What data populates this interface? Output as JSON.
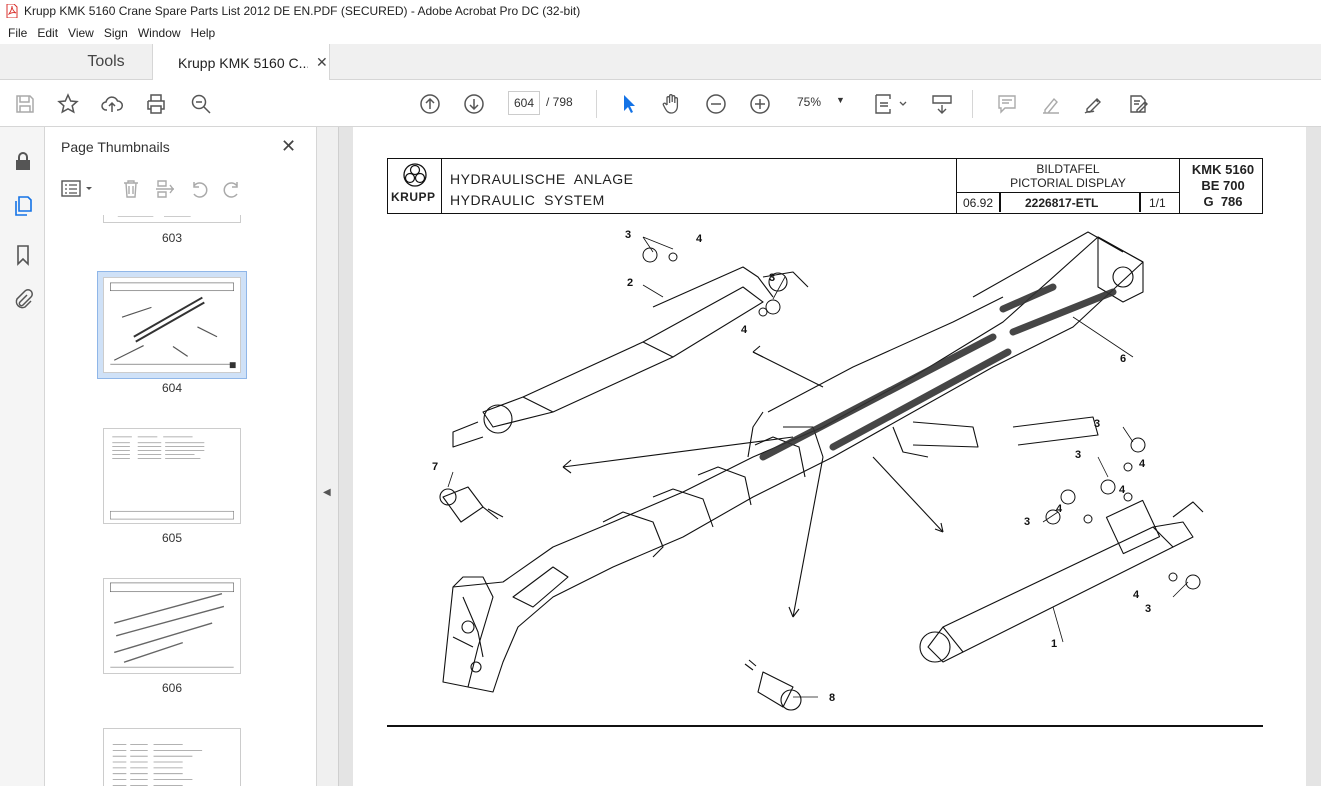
{
  "window": {
    "title": "Krupp KMK 5160 Crane Spare Parts List 2012 DE EN.PDF (SECURED) - Adobe Acrobat Pro DC (32-bit)"
  },
  "menu": [
    "File",
    "Edit",
    "View",
    "Sign",
    "Window",
    "Help"
  ],
  "tabs": {
    "tools": "Tools",
    "document": "Krupp KMK 5160 C..."
  },
  "toolbar": {
    "current_page": "604",
    "total_pages": "/ 798",
    "zoom": "75%"
  },
  "panel": {
    "title": "Page Thumbnails",
    "thumbnails": [
      {
        "page": "603"
      },
      {
        "page": "604",
        "selected": true
      },
      {
        "page": "605"
      },
      {
        "page": "606"
      }
    ]
  },
  "document": {
    "header": {
      "logo_text": "KRUPP",
      "title_de": "HYDRAULISCHE  ANLAGE",
      "title_en": "HYDRAULIC  SYSTEM",
      "label_de": "BILDTAFEL",
      "label_en": "PICTORIAL DISPLAY",
      "date": "06.92",
      "part_number": "2226817-ETL",
      "sheet": "1/1",
      "model_1": "KMK 5160",
      "model_2": "BE 700",
      "model_3": "G  786"
    },
    "callouts": [
      "3",
      "4",
      "2",
      "3",
      "4",
      "6",
      "7",
      "3",
      "4",
      "3",
      "4",
      "3",
      "4",
      "4",
      "3",
      "1",
      "8"
    ]
  },
  "colors": {
    "accent": "#1473e6",
    "toolbar_bg": "#ffffff",
    "tab_bg": "#f0f0f0",
    "doc_bg": "#e4e4e4"
  }
}
